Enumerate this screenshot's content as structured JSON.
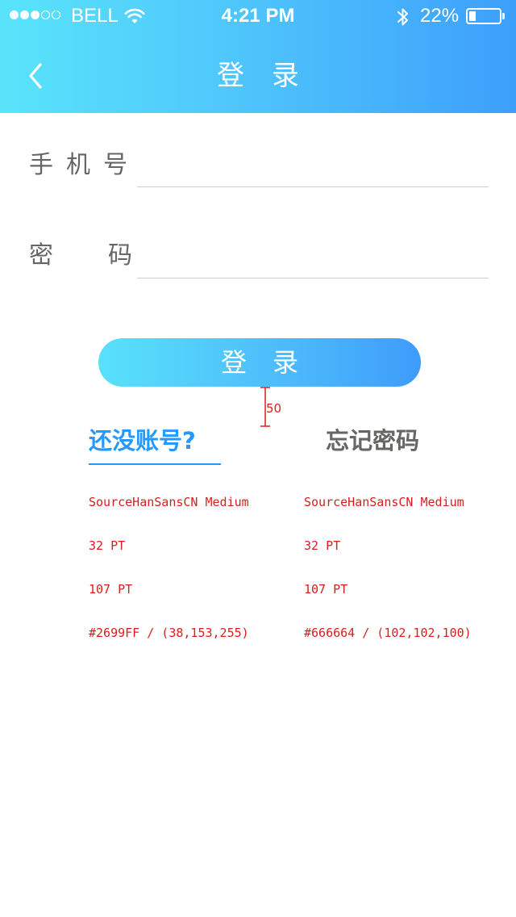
{
  "status_bar": {
    "carrier": "BELL",
    "time": "4:21 PM",
    "battery_percent": "22%",
    "battery_level": 0.22,
    "signal_bars_filled": 3,
    "signal_bars_total": 5,
    "icons": [
      "signal-dots-icon",
      "wifi-icon",
      "bluetooth-icon",
      "battery-icon"
    ]
  },
  "nav": {
    "title": "登录",
    "back_icon": "chevron-left-icon"
  },
  "form": {
    "phone_label": "手机号",
    "phone_value": "",
    "password_label_a": "密",
    "password_label_b": "码",
    "password_value": ""
  },
  "login_button": {
    "label": "登录"
  },
  "measure": {
    "label": "50"
  },
  "links": {
    "register": "还没账号?",
    "forgot": "忘记密码"
  },
  "annotations": {
    "register": {
      "font": "SourceHanSansCN Medium",
      "size": "32 PT",
      "line": "107 PT",
      "color": "#2699FF / (38,153,255)"
    },
    "forgot": {
      "font": "SourceHanSansCN Medium",
      "size": "32 PT",
      "line": "107 PT",
      "color": "#666664 / (102,102,100)"
    }
  },
  "colors": {
    "accent": "#2699FF",
    "gradient_start": "#59E4FB",
    "gradient_end": "#3D9FFB",
    "secondary_text": "#666664",
    "annotation": "#D81E1E"
  }
}
